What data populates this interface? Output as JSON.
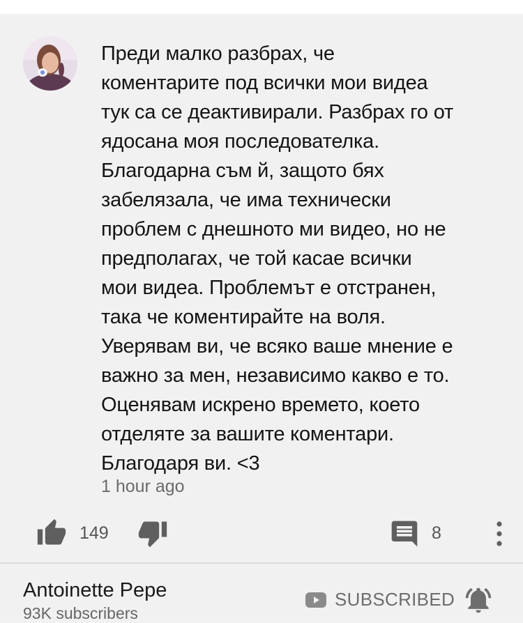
{
  "comment": {
    "text": "Преди малко разбрах, че\nкоментарите под всички мои видеа\nтук са се деактивирали. Разбрах го от\nядосана моя последователка.\nБлагодарна съм й, защото бях\nзабелязала, че има технически\nпроблем с днешното ми видео, но не\nпредполагах, че той касае всички\nмои видеа. Проблемът е отстранен,\nтака че коментирайте на воля.\nУверявам ви, че всяко ваше мнение е\nважно за мен, независимо какво е то.\nОценявам искрено времето, което\nотделяте за вашите коментари.\nБлагодаря ви. <3",
    "timestamp": "1 hour ago",
    "like_count": "149",
    "reply_count": "8",
    "icons": {
      "like": "thumbs-up-icon",
      "dislike": "thumbs-down-icon",
      "reply": "comment-icon",
      "more": "more-vert-icon"
    }
  },
  "channel": {
    "name": "Antoinette Pepe",
    "subscribers": "93K subscribers",
    "subscribe_label": "SUBSCRIBED",
    "icons": {
      "subscribe": "youtube-play-icon",
      "notifications": "bell-ringing-icon"
    }
  },
  "colors": {
    "background": "#f1f1f1",
    "text": "#141414",
    "secondary_text": "#6b6b6b",
    "icon": "#5f5f5f"
  }
}
